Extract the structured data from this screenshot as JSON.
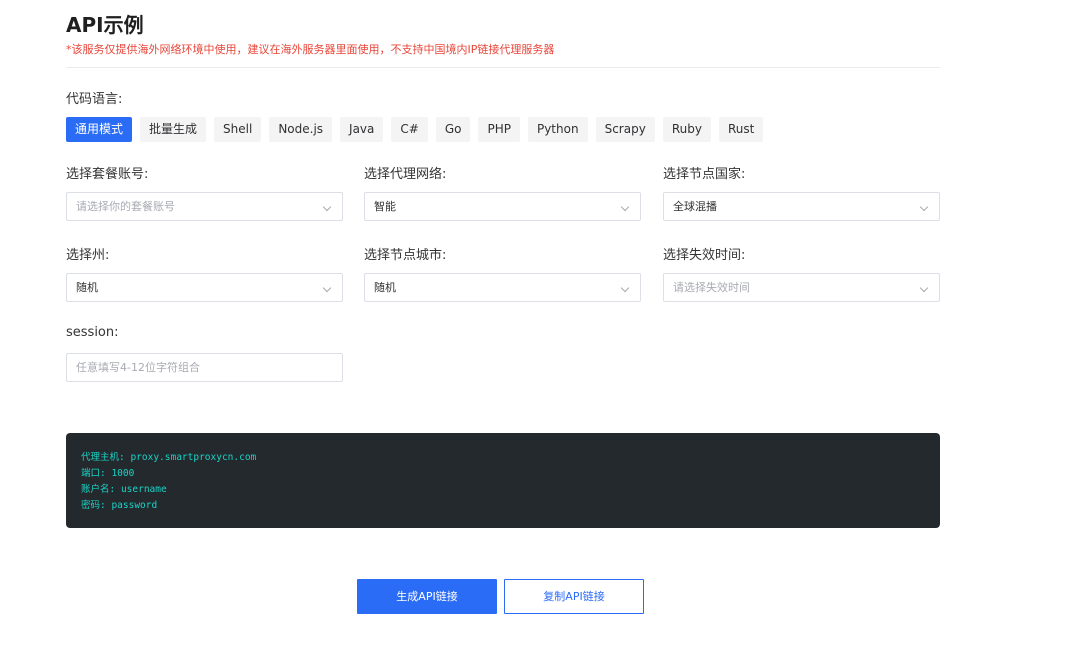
{
  "header": {
    "title": "API示例",
    "notice": "*该服务仅提供海外网络环境中使用，建议在海外服务器里面使用，不支持中国境内IP链接代理服务器"
  },
  "language": {
    "label": "代码语言:",
    "tabs": [
      "通用模式",
      "批量生成",
      "Shell",
      "Node.js",
      "Java",
      "C#",
      "Go",
      "PHP",
      "Python",
      "Scrapy",
      "Ruby",
      "Rust"
    ],
    "active": "通用模式"
  },
  "form": {
    "package_account": {
      "label": "选择套餐账号:",
      "placeholder": "请选择你的套餐账号"
    },
    "proxy_network": {
      "label": "选择代理网络:",
      "value": "智能"
    },
    "node_country": {
      "label": "选择节点国家:",
      "value": "全球混播"
    },
    "state": {
      "label": "选择州:",
      "value": "随机"
    },
    "node_city": {
      "label": "选择节点城市:",
      "value": "随机"
    },
    "expiry": {
      "label": "选择失效时间:",
      "placeholder": "请选择失效时间"
    },
    "session": {
      "label": "session:",
      "placeholder": "任意填写4-12位字符组合"
    }
  },
  "code_output": [
    "代理主机: proxy.smartproxycn.com",
    "端口: 1000",
    "账户名: username",
    "密码: password"
  ],
  "buttons": {
    "generate": "生成API链接",
    "copy": "复制API链接"
  },
  "colors": {
    "accent": "#2b6cf6",
    "notice": "#e8463a",
    "code_bg": "#24292e",
    "code_text": "#19d3c5"
  }
}
